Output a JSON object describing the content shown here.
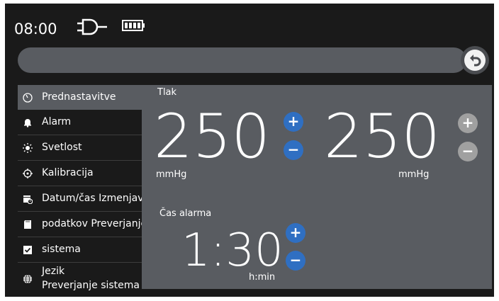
{
  "status": {
    "time": "08:00"
  },
  "sidebar": {
    "items": [
      {
        "label": "Prednastavitve",
        "icon": "gauge-icon"
      },
      {
        "label": "Alarm",
        "icon": "bell-icon"
      },
      {
        "label": "Svetlost",
        "icon": "brightness-icon"
      },
      {
        "label": "Kalibracija",
        "icon": "crosshair-icon"
      },
      {
        "label": "Datum/čas Izmenjava",
        "icon": "calendar-clock-icon"
      },
      {
        "label": "podatkov Preverjanje",
        "icon": "sd-card-icon"
      },
      {
        "label": "sistema",
        "icon": "checkbox-icon"
      },
      {
        "label": "Jezik",
        "label2": "Preverjanje sistema",
        "icon": "globe-icon"
      }
    ]
  },
  "pressure": {
    "title": "Tlak",
    "left_value": "250",
    "left_unit": "mmHg",
    "right_value": "250",
    "right_unit": "mmHg"
  },
  "alarm_time": {
    "title": "Čas alarma",
    "value": "1:30",
    "unit": "h:min"
  },
  "buttons": {
    "plus": "+",
    "minus": "−"
  },
  "colors": {
    "accent": "#2f6fc2",
    "panel": "#595c61",
    "background": "#1a1a1a",
    "disabled": "#a0a0a0"
  }
}
